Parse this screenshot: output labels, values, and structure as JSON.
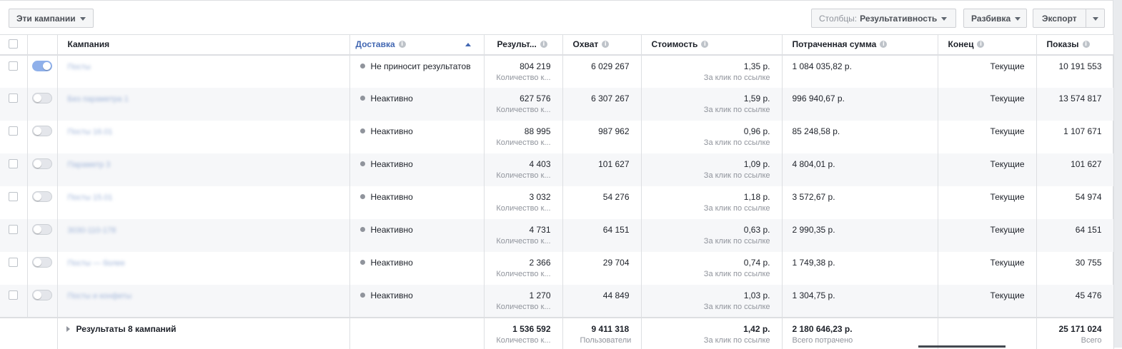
{
  "toolbar": {
    "campaigns_filter_label": "Эти кампании",
    "columns_prefix": "Столбцы:",
    "columns_value": "Результативность",
    "breakdown_label": "Разбивка",
    "export_label": "Экспорт"
  },
  "columns": {
    "campaign": "Кампания",
    "delivery": "Доставка",
    "results": "Результ...",
    "reach": "Охват",
    "cost": "Стоимость",
    "spent": "Потраченная сумма",
    "end": "Конец",
    "impressions": "Показы"
  },
  "rows": [
    {
      "name": "Посты",
      "active": true,
      "delivery": "Не приносит результатов",
      "results": "804 219",
      "results_sub": "Количество к...",
      "reach": "6 029 267",
      "cost": "1,35 р.",
      "cost_sub": "За клик по ссылке",
      "spent": "1 084 035,82 р.",
      "end": "Текущие",
      "impressions": "10 191 553"
    },
    {
      "name": "Без параметра 1",
      "active": false,
      "delivery": "Неактивно",
      "results": "627 576",
      "results_sub": "Количество к...",
      "reach": "6 307 267",
      "cost": "1,59 р.",
      "cost_sub": "За клик по ссылке",
      "spent": "996 940,67 р.",
      "end": "Текущие",
      "impressions": "13 574 817"
    },
    {
      "name": "Посты 16.01",
      "active": false,
      "delivery": "Неактивно",
      "results": "88 995",
      "results_sub": "Количество к...",
      "reach": "987 962",
      "cost": "0,96 р.",
      "cost_sub": "За клик по ссылке",
      "spent": "85 248,58 р.",
      "end": "Текущие",
      "impressions": "1 107 671"
    },
    {
      "name": "Параметр 3",
      "active": false,
      "delivery": "Неактивно",
      "results": "4 403",
      "results_sub": "Количество к...",
      "reach": "101 627",
      "cost": "1,09 р.",
      "cost_sub": "За клик по ссылке",
      "spent": "4 804,01 р.",
      "end": "Текущие",
      "impressions": "101 627"
    },
    {
      "name": "Посты 15.01",
      "active": false,
      "delivery": "Неактивно",
      "results": "3 032",
      "results_sub": "Количество к...",
      "reach": "54 276",
      "cost": "1,18 р.",
      "cost_sub": "За клик по ссылке",
      "spent": "3 572,67 р.",
      "end": "Текущие",
      "impressions": "54 974"
    },
    {
      "name": "3030-110-178",
      "active": false,
      "delivery": "Неактивно",
      "results": "4 731",
      "results_sub": "Количество к...",
      "reach": "64 151",
      "cost": "0,63 р.",
      "cost_sub": "За клик по ссылке",
      "spent": "2 990,35 р.",
      "end": "Текущие",
      "impressions": "64 151"
    },
    {
      "name": "Посты — более",
      "active": false,
      "delivery": "Неактивно",
      "results": "2 366",
      "results_sub": "Количество к...",
      "reach": "29 704",
      "cost": "0,74 р.",
      "cost_sub": "За клик по ссылке",
      "spent": "1 749,38 р.",
      "end": "Текущие",
      "impressions": "30 755"
    },
    {
      "name": "Посты и конфеты",
      "active": false,
      "delivery": "Неактивно",
      "results": "1 270",
      "results_sub": "Количество к...",
      "reach": "44 849",
      "cost": "1,03 р.",
      "cost_sub": "За клик по ссылке",
      "spent": "1 304,75 р.",
      "end": "Текущие",
      "impressions": "45 476"
    }
  ],
  "totals": {
    "label": "Результаты 8 кампаний",
    "results": "1 536 592",
    "results_sub": "Количество к...",
    "reach": "9 411 318",
    "reach_sub": "Пользователи",
    "cost": "1,42 р.",
    "cost_sub": "За клик по ссылке",
    "spent": "2 180 646,23 р.",
    "spent_sub": "Всего потрачено",
    "impressions": "25 171 024",
    "impressions_sub": "Всего"
  },
  "colors": {
    "accent": "#4267b2",
    "toggle_on": "#8fb0ea",
    "status_dot": "#90949c"
  }
}
